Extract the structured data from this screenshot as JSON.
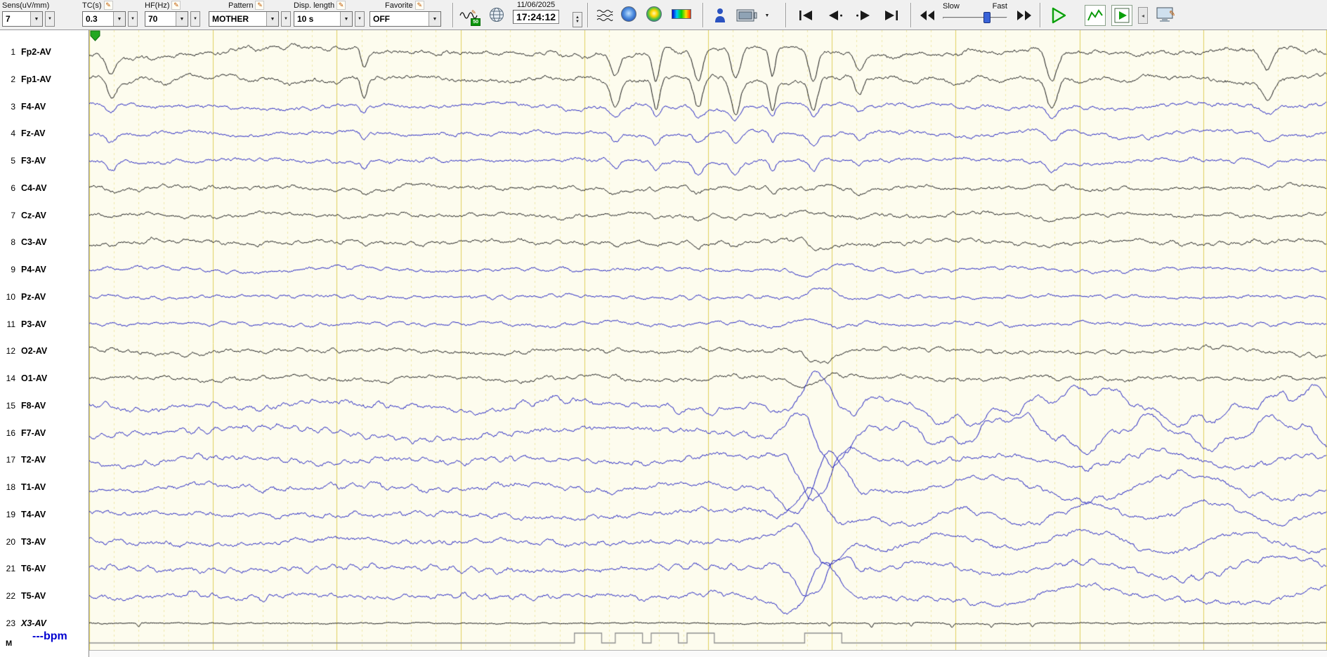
{
  "toolbar": {
    "sens": {
      "label": "Sens(uV/mm)",
      "value": "7"
    },
    "tc": {
      "label": "TC(s)",
      "value": "0.3"
    },
    "hf": {
      "label": "HF(Hz)",
      "value": "70"
    },
    "pattern": {
      "label": "Pattern",
      "value": "MOTHER"
    },
    "disp_length": {
      "label": "Disp. length",
      "value": "10 s"
    },
    "favorite": {
      "label": "Favorite",
      "value": "OFF"
    },
    "notch_badge": "50",
    "date": "11/06/2025",
    "time": "17:24:12",
    "slow_label": "Slow",
    "fast_label": "Fast"
  },
  "channels": [
    {
      "num": "1",
      "label": "Fp2-AV",
      "color": "#151515",
      "kind": "frontal",
      "italic": false
    },
    {
      "num": "2",
      "label": "Fp1-AV",
      "color": "#151515",
      "kind": "frontal",
      "italic": false
    },
    {
      "num": "3",
      "label": "F4-AV",
      "color": "#1a1ac0",
      "kind": "frontal2",
      "italic": false
    },
    {
      "num": "4",
      "label": "Fz-AV",
      "color": "#1a1ac0",
      "kind": "frontal2",
      "italic": false
    },
    {
      "num": "5",
      "label": "F3-AV",
      "color": "#1a1ac0",
      "kind": "frontal2",
      "italic": false
    },
    {
      "num": "6",
      "label": "C4-AV",
      "color": "#151515",
      "kind": "central",
      "italic": false
    },
    {
      "num": "7",
      "label": "Cz-AV",
      "color": "#151515",
      "kind": "central",
      "italic": false
    },
    {
      "num": "8",
      "label": "C3-AV",
      "color": "#151515",
      "kind": "central",
      "italic": false
    },
    {
      "num": "9",
      "label": "P4-AV",
      "color": "#1a1ac0",
      "kind": "parietal",
      "italic": false
    },
    {
      "num": "10",
      "label": "Pz-AV",
      "color": "#1a1ac0",
      "kind": "parietal",
      "italic": false
    },
    {
      "num": "11",
      "label": "P3-AV",
      "color": "#1a1ac0",
      "kind": "parietal",
      "italic": false
    },
    {
      "num": "12",
      "label": "O2-AV",
      "color": "#151515",
      "kind": "occipital",
      "italic": false
    },
    {
      "num": "14",
      "label": "O1-AV",
      "color": "#151515",
      "kind": "occipital",
      "italic": false
    },
    {
      "num": "15",
      "label": "F8-AV",
      "color": "#1a1ac0",
      "kind": "temporal",
      "italic": false
    },
    {
      "num": "16",
      "label": "F7-AV",
      "color": "#1a1ac0",
      "kind": "temporal",
      "italic": false
    },
    {
      "num": "17",
      "label": "T2-AV",
      "color": "#1a1ac0",
      "kind": "temporal",
      "italic": false
    },
    {
      "num": "18",
      "label": "T1-AV",
      "color": "#1a1ac0",
      "kind": "temporal",
      "italic": false
    },
    {
      "num": "19",
      "label": "T4-AV",
      "color": "#1a1ac0",
      "kind": "temporal",
      "italic": false
    },
    {
      "num": "20",
      "label": "T3-AV",
      "color": "#1a1ac0",
      "kind": "temporal",
      "italic": false
    },
    {
      "num": "21",
      "label": "T6-AV",
      "color": "#1a1ac0",
      "kind": "temporal",
      "italic": false
    },
    {
      "num": "22",
      "label": "T5-AV",
      "color": "#1a1ac0",
      "kind": "temporal",
      "italic": false
    },
    {
      "num": "23",
      "label": "X3-AV",
      "color": "#151515",
      "kind": "ecg",
      "italic": true
    }
  ],
  "bottom": {
    "bpm": "---bpm",
    "marker_label": "M"
  },
  "display_seconds": 10,
  "marker_pulses": [
    [
      0.392,
      0.414
    ],
    [
      0.425,
      0.447
    ],
    [
      0.454,
      0.476
    ],
    [
      0.483,
      0.505
    ],
    [
      0.578,
      0.608
    ]
  ],
  "colors": {
    "bg": "#fdfcee",
    "grid_major": "#e0d060",
    "grid_minor": "#efe8ab",
    "marker": "#8f8f8f",
    "flag": "#22a822"
  }
}
